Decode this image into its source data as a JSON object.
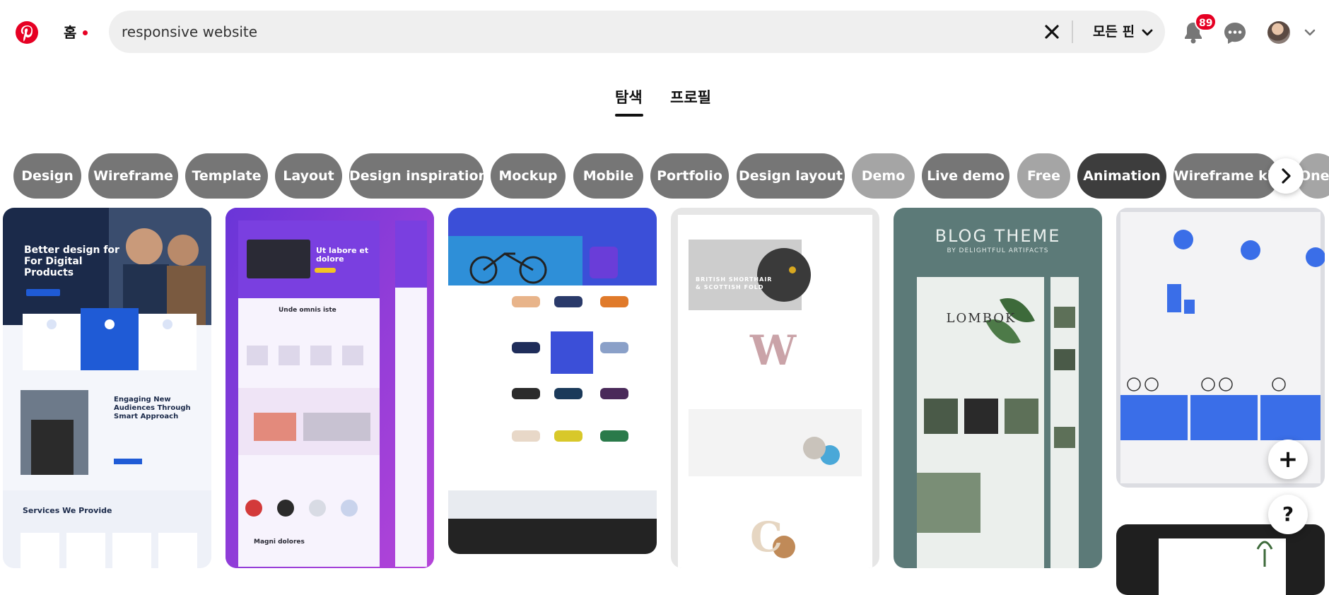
{
  "header": {
    "home_label": "홈",
    "search_value": "responsive website",
    "scope_label": "모든 핀",
    "notification_count": "89",
    "brand_color": "#e60023"
  },
  "tabs": [
    {
      "label": "탐색",
      "active": true
    },
    {
      "label": "프로필",
      "active": false
    }
  ],
  "chips": [
    {
      "label": "Design",
      "color": "#767676"
    },
    {
      "label": "Wireframe",
      "color": "#767676"
    },
    {
      "label": "Template",
      "color": "#767676"
    },
    {
      "label": "Layout",
      "color": "#767676"
    },
    {
      "label": "Design inspiration",
      "color": "#767676"
    },
    {
      "label": "Mockup",
      "color": "#767676"
    },
    {
      "label": "Mobile",
      "color": "#767676"
    },
    {
      "label": "Portfolio",
      "color": "#767676"
    },
    {
      "label": "Design layout",
      "color": "#767676"
    },
    {
      "label": "Demo",
      "color": "#a5a5a5"
    },
    {
      "label": "Live demo",
      "color": "#767676"
    },
    {
      "label": "Free",
      "color": "#a5a5a5"
    },
    {
      "label": "Animation",
      "color": "#3d3d3d"
    },
    {
      "label": "Wireframe kit",
      "color": "#767676"
    },
    {
      "label": "One",
      "color": "#a5a5a5"
    }
  ],
  "pins": [
    {
      "headline": "Better design for For Digital Products",
      "subhead": "Engaging New Audiences Through Smart Approach",
      "footer": "Services We Provide"
    },
    {
      "headline": "Ut labore et dolore",
      "subhead": "Unde omnis iste",
      "footer": "Magni dolores"
    },
    {
      "headline": "",
      "subhead": "",
      "footer": ""
    },
    {
      "headline": "BRITISH SHORTHAIR & SCOTTISH FOLD",
      "subhead": "W",
      "footer": "C"
    },
    {
      "headline": "BLOG THEME",
      "subhead": "BY DELIGHTFUL ARTIFACTS",
      "footer": "LOMBOK"
    },
    {
      "headline": "",
      "subhead": "",
      "footer": ""
    }
  ],
  "fab": {
    "add": "+",
    "help": "?"
  }
}
